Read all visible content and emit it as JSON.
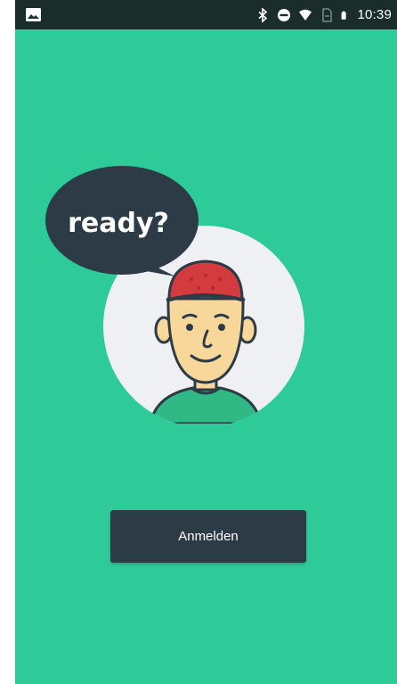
{
  "status_bar": {
    "left_icon": "image-notification-icon",
    "icons": [
      "bluetooth-icon",
      "do-not-disturb-icon",
      "wifi-icon",
      "sim-icon",
      "battery-icon"
    ],
    "time": "10:39"
  },
  "illustration": {
    "speech_bubble_text": "ready?",
    "avatar": "person-with-red-cap-illustration"
  },
  "login_button": {
    "label": "Anmelden"
  },
  "colors": {
    "background": "#2ecb98",
    "button": "#2d3b47",
    "speech_bubble": "#2d3b47",
    "avatar_circle": "#eef0f3",
    "cap": "#d33b3f",
    "skin": "#f7d89a"
  }
}
